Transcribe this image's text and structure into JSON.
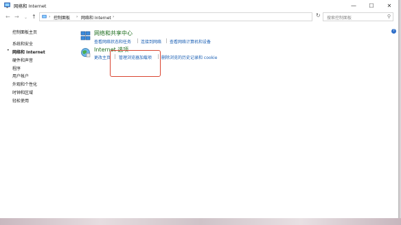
{
  "window": {
    "title": "网络和 Internet",
    "icons": {
      "app": "control-panel-icon",
      "min": "minimize-icon",
      "max": "maximize-icon",
      "close": "close-icon"
    },
    "controls": {
      "minimize": "—",
      "maximize": "☐",
      "close": "✕"
    }
  },
  "nav": {
    "back": "←",
    "forward": "→",
    "up": "↑",
    "dropdown": "⌄"
  },
  "address": {
    "sep": "›",
    "crumbs": [
      "控制面板",
      "网络和 Internet"
    ],
    "refresh": "↻"
  },
  "search": {
    "placeholder": "搜索控制面板",
    "icon": "search-icon"
  },
  "sidebar": {
    "items": [
      "控制面板主页",
      "系统和安全",
      "网络和 Internet",
      "硬件和声音",
      "程序",
      "用户帐户",
      "外观和个性化",
      "时钟和区域",
      "轻松使用"
    ],
    "active_index": 2,
    "bullet": "•"
  },
  "categories": {
    "network_center": {
      "title": "网络和共享中心",
      "links": [
        "查看网络状态和任务",
        "连接到网络",
        "查看网络计算机和设备"
      ]
    },
    "internet_options": {
      "title": "Internet 选项",
      "links": [
        "更改主页",
        "管理浏览器加载项",
        "删除浏览的历史记录和 cookie"
      ]
    }
  },
  "help": "?",
  "colors": {
    "accent_link": "#1a5fb4",
    "category_title": "#1e6e1e",
    "highlight_box": "#d9432f"
  }
}
